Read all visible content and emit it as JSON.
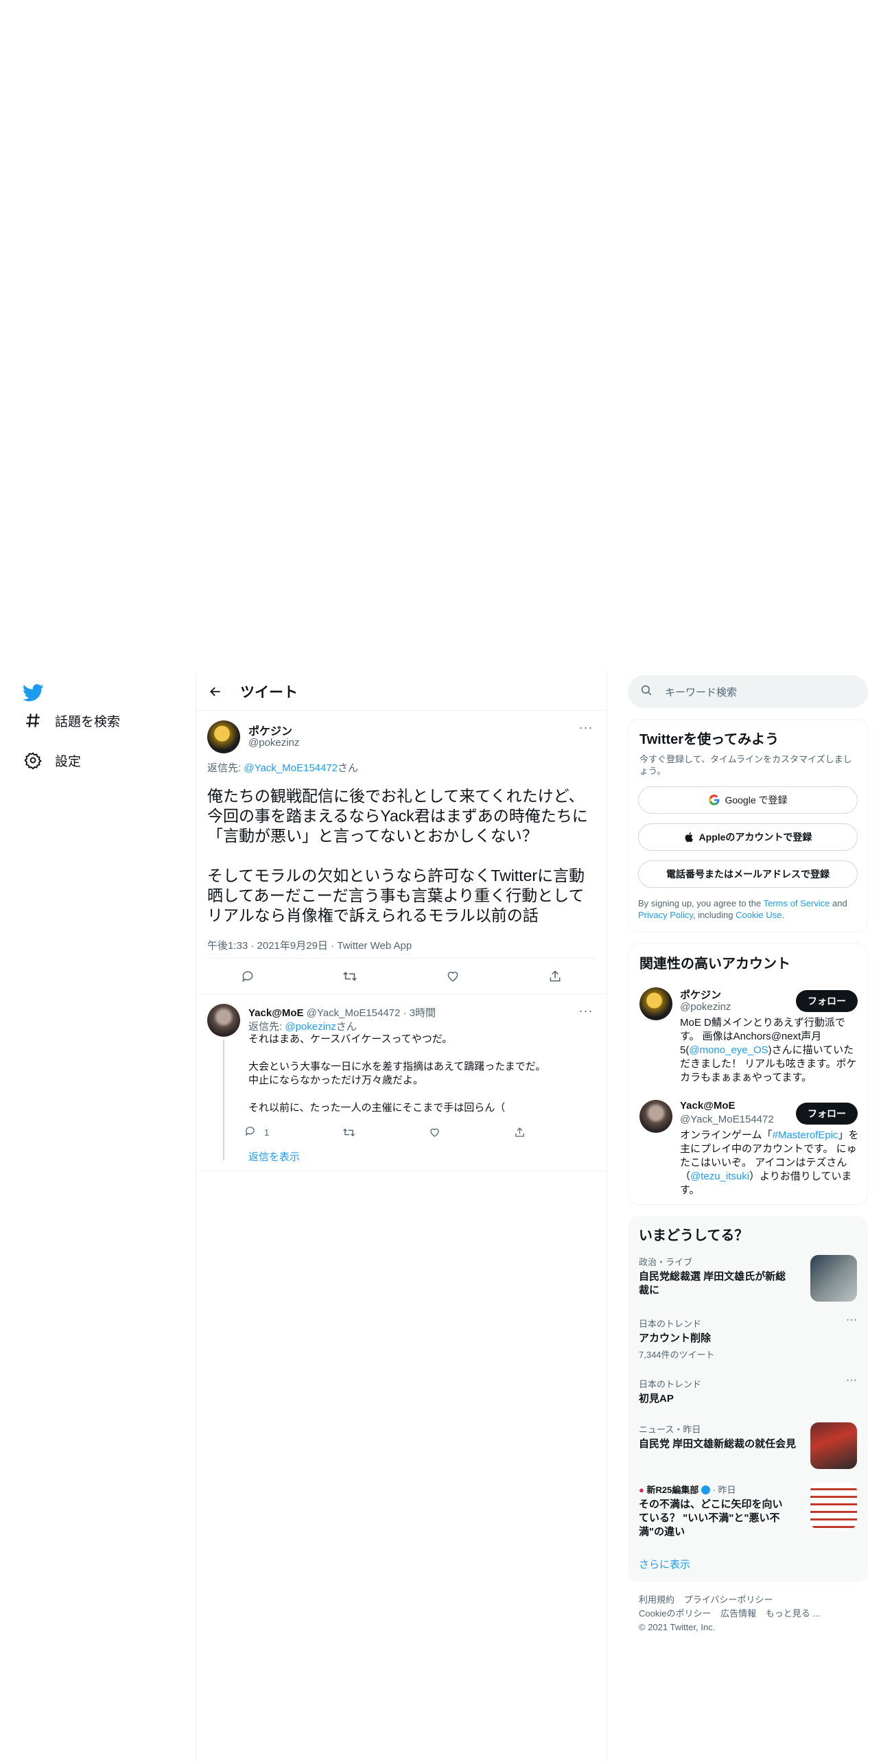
{
  "nav": {
    "items": [
      {
        "label": "話題を検索",
        "icon": "hashtag-icon"
      },
      {
        "label": "設定",
        "icon": "gear-icon"
      }
    ]
  },
  "header": {
    "title": "ツイート"
  },
  "focused_tweet": {
    "name": "ポケジン",
    "handle": "@pokezinz",
    "reply_prefix": "返信先: ",
    "reply_to": "@Yack_MoE154472",
    "reply_suffix": "さん",
    "text": "俺たちの観戦配信に後でお礼として来てくれたけど、今回の事を踏まえるならYack君はまずあの時俺たちに「言動が悪い」と言ってないとおかしくない？\n\nそしてモラルの欠如というなら許可なくTwitterに言動晒してあーだこーだ言う事も言葉より重く行動としてリアルなら肖像権で訴えられるモラル以前の話",
    "timestamp": "午後1:33 · 2021年9月29日 · Twitter Web App"
  },
  "reply_tweet": {
    "name": "Yack@MoE",
    "handle_time": "@Yack_MoE154472 · 3時間",
    "reply_prefix": "返信先: ",
    "reply_to": "@pokezinz",
    "reply_suffix": "さん",
    "text": "それはまあ、ケースバイケースってやつだ。\n\n大会という大事な一日に水を差す指摘はあえて躊躇ったまでだ。\n中止にならなかっただけ万々歳だよ。\n\nそれ以前に、たった一人の主催にそこまで手は回らん（",
    "reply_count": "1",
    "show_replies": "返信を表示"
  },
  "search": {
    "placeholder": "キーワード検索"
  },
  "signup": {
    "title": "Twitterを使ってみよう",
    "subtitle": "今すぐ登録して、タイムラインをカスタマイズしましょう。",
    "google_label": "Google で登録",
    "apple_label": "Appleのアカウントで登録",
    "phone_label": "電話番号またはメールアドレスで登録",
    "terms_1": "By signing up, you agree to the ",
    "terms_link1": "Terms of Service",
    "terms_2": " and ",
    "terms_link2": "Privacy Policy",
    "terms_3": ", including ",
    "terms_link3": "Cookie Use",
    "terms_4": "."
  },
  "related": {
    "title": "関連性の高いアカウント",
    "follow_label": "フォロー",
    "accounts": [
      {
        "name": "ポケジン",
        "handle": "@pokezinz",
        "bio_1": "MoE D鯖メインとりあえず行動派です。 画像はAnchors@next声月5(",
        "bio_link": "@mono_eye_OS",
        "bio_2": ")さんに描いていただきました！ リアルも呟きます。ポケカラもまぁまぁやってます。"
      },
      {
        "name": "Yack@MoE",
        "handle": "@Yack_MoE154472",
        "bio_1": "オンラインゲーム「",
        "bio_link": "#MasterofEpic",
        "bio_2": "」を主にプレイ中のアカウントです。 にゅたこはいいぞ。 アイコンはテズさん（",
        "bio_link2": "@tezu_itsuki",
        "bio_3": "）よりお借りしています。"
      }
    ]
  },
  "trends": {
    "title": "いまどうしてる？",
    "items": [
      {
        "context": "政治・ライブ",
        "title": "自民党総裁選 岸田文雄氏が新総裁に"
      },
      {
        "context": "日本のトレンド",
        "title": "アカウント削除",
        "count": "7,344件のツイート"
      },
      {
        "context": "日本のトレンド",
        "title": "初見AP"
      },
      {
        "context": "ニュース・昨日",
        "title": "自民党 岸田文雄新総裁の就任会見"
      },
      {
        "context_source": "新R25編集部",
        "context_time": " · 昨日",
        "title": "その不満は、どこに矢印を向いている？ \"いい不満\"と\"悪い不満\"の違い"
      }
    ],
    "show_more": "さらに表示"
  },
  "footer": {
    "links": [
      "利用規約",
      "プライバシーポリシー",
      "Cookieのポリシー",
      "広告情報",
      "もっと見る ..."
    ],
    "copyright": "© 2021 Twitter, Inc."
  },
  "colors": {
    "accent": "#1d9bf0",
    "text": "#0f1419",
    "muted": "#536471",
    "border": "#eff3f4"
  }
}
